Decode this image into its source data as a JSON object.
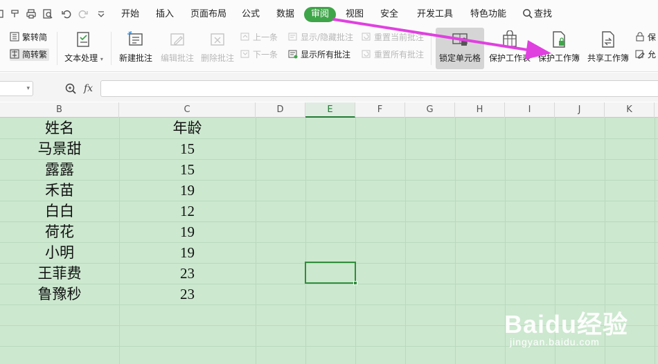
{
  "menu": {
    "quick_access_icons": [
      "copy-icon",
      "format-painter-icon",
      "print-icon",
      "print-preview-icon",
      "undo-icon",
      "redo-icon",
      "more-dropdown-icon"
    ],
    "tabs": [
      "开始",
      "插入",
      "页面布局",
      "公式",
      "数据",
      "审阅",
      "视图",
      "安全",
      "开发工具",
      "特色功能"
    ],
    "active_tab": "审阅",
    "search_label": "查找"
  },
  "ribbon": {
    "trad_to_simp": "繁转简",
    "simp_to_trad": "简转繁",
    "text_process": "文本处理",
    "new_comment": "新建批注",
    "edit_comment": "编辑批注",
    "delete_comment": "删除批注",
    "prev": "上一条",
    "next": "下一条",
    "show_hide_comment": "显示/隐藏批注",
    "show_all_comments": "显示所有批注",
    "reset_current_comment": "重置当前批注",
    "reset_all_comments": "重置所有批注",
    "lock_cell": "锁定单元格",
    "protect_sheet": "保护工作表",
    "protect_workbook": "保护工作簿",
    "share_workbook": "共享工作簿",
    "protect_partial": "保",
    "allow_partial": "允"
  },
  "formula_bar": {
    "fx_label": "fx",
    "value": ""
  },
  "columns": [
    "B",
    "C",
    "D",
    "E",
    "F",
    "G",
    "H",
    "I",
    "J",
    "K"
  ],
  "selected_column": "E",
  "table": {
    "header": [
      "姓名",
      "年龄"
    ],
    "rows": [
      [
        "马景甜",
        "15"
      ],
      [
        "露露",
        "15"
      ],
      [
        "禾苗",
        "19"
      ],
      [
        "白白",
        "12"
      ],
      [
        "荷花",
        "19"
      ],
      [
        "小明",
        "19"
      ],
      [
        "王菲费",
        "23"
      ],
      [
        "鲁豫秒",
        "23"
      ]
    ]
  },
  "watermark": {
    "brand": "Baidu经验",
    "url": "jingyan.baidu.com"
  },
  "colors": {
    "accent": "#3fa549",
    "grid_bg": "#cce8cf",
    "arrow": "#e040e0"
  }
}
